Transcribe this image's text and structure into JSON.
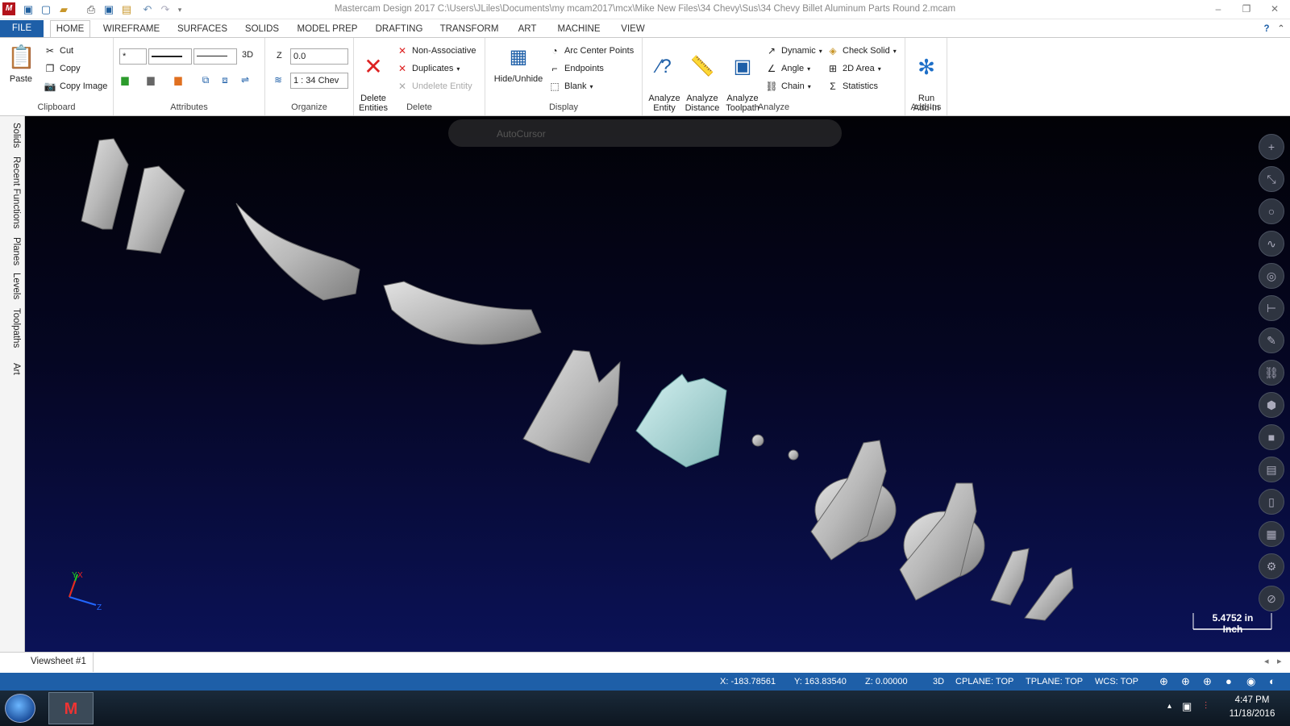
{
  "title": "Mastercam Design 2017  C:\\Users\\JLiles\\Documents\\my mcam2017\\mcx\\Mike New Files\\34 Chevy\\Sus\\34 Chevy Billet Aluminum Parts Round 2.mcam",
  "tabs": [
    "FILE",
    "HOME",
    "WIREFRAME",
    "SURFACES",
    "SOLIDS",
    "MODEL PREP",
    "DRAFTING",
    "TRANSFORM",
    "ART",
    "MACHINE",
    "VIEW"
  ],
  "clipboard": {
    "label": "Clipboard",
    "paste": "Paste",
    "cut": "Cut",
    "copy": "Copy",
    "copy_image": "Copy Image"
  },
  "attributes": {
    "label": "Attributes",
    "point": "*",
    "mode": "3D"
  },
  "organize": {
    "label": "Organize",
    "z_label": "Z",
    "z_value": "0.0",
    "level": "1 : 34 Chev"
  },
  "delete": {
    "label": "Delete",
    "delete_entities": "Delete\nEntities",
    "non_assoc": "Non-Associative",
    "duplicates": "Duplicates",
    "undelete": "Undelete Entity"
  },
  "display": {
    "label": "Display",
    "hide": "Hide/Unhide",
    "arc": "Arc Center Points",
    "endpoints": "Endpoints",
    "blank": "Blank"
  },
  "analyze": {
    "label": "Analyze",
    "entity": "Analyze\nEntity",
    "distance": "Analyze\nDistance",
    "toolpath": "Analyze\nToolpath",
    "dynamic": "Dynamic",
    "angle": "Angle",
    "chain": "Chain",
    "check_solid": "Check Solid",
    "area": "2D Area",
    "statistics": "Statistics"
  },
  "addins": {
    "label": "Add-Ins",
    "run": "Run\nAdd-In"
  },
  "side_tabs": [
    "Solids",
    "Recent Functions",
    "Planes",
    "Levels",
    "Toolpaths",
    "Art"
  ],
  "autocursor": "AutoCursor",
  "axes": {
    "y": "Y",
    "x": "X",
    "z": "Z"
  },
  "scale": {
    "value": "5.4752 in",
    "unit": "Inch"
  },
  "viewsheet": "Viewsheet #1",
  "status": {
    "x": "X:  -183.78561",
    "y": "Y:  163.83540",
    "z": "Z:  0.00000",
    "mode": "3D",
    "cplane": "CPLANE: TOP",
    "tplane": "TPLANE: TOP",
    "wcs": "WCS: TOP"
  },
  "clock": {
    "time": "4:47 PM",
    "date": "11/18/2016"
  }
}
